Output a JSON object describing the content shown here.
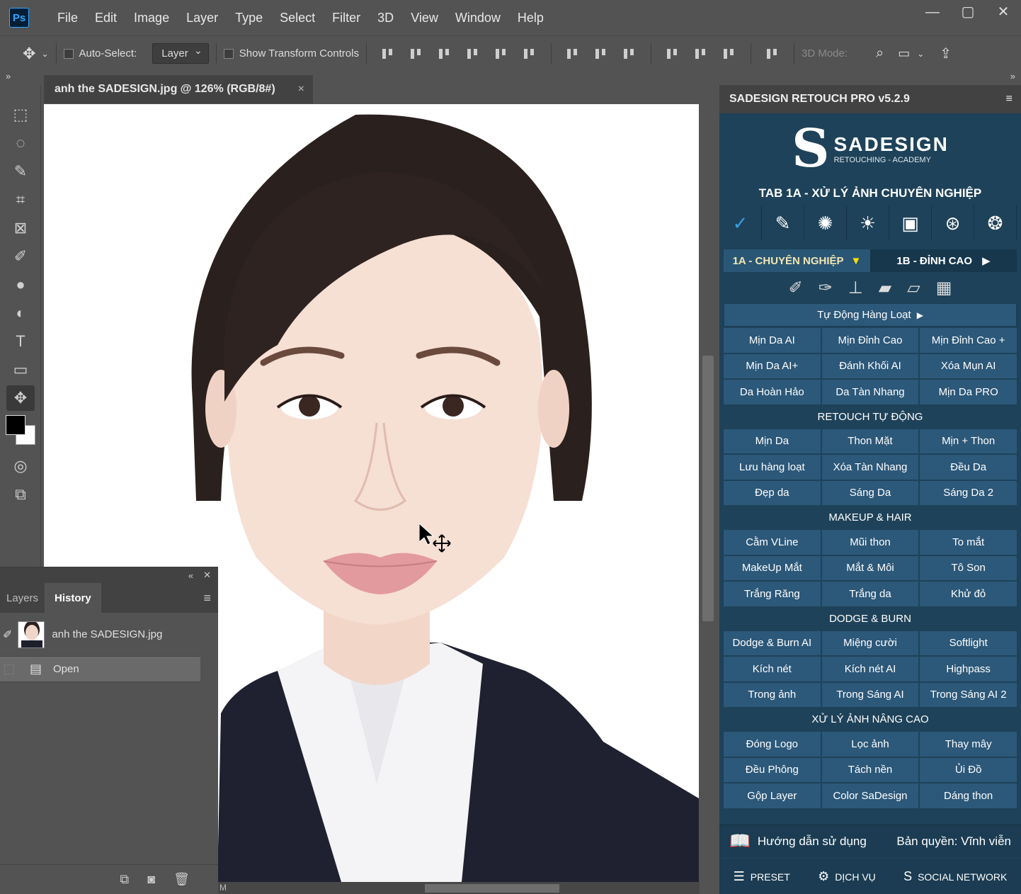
{
  "app": {
    "logo": "Ps"
  },
  "menu": [
    "File",
    "Edit",
    "Image",
    "Layer",
    "Type",
    "Select",
    "Filter",
    "3D",
    "View",
    "Window",
    "Help"
  ],
  "window_controls": [
    "—",
    "▢",
    "✕"
  ],
  "options": {
    "auto_select_label": "Auto-Select:",
    "auto_select_value": "Layer",
    "transform_label": "Show Transform Controls",
    "mode3d_label": "3D Mode:"
  },
  "document": {
    "tab_title": "anh the SADESIGN.jpg @ 126% (RGB/8#)",
    "close": "×"
  },
  "statusbar": {
    "zoom_fragment": "M"
  },
  "history_panel": {
    "tabs": [
      "Layers",
      "History"
    ],
    "snapshot_label": "anh the SADESIGN.jpg",
    "states": [
      "Open"
    ]
  },
  "sadesign": {
    "header": "SADESIGN RETOUCH PRO v5.2.9",
    "logo_main": "SADESIGN",
    "logo_sub": "RETOUCHING - ACADEMY",
    "title": "TAB 1A - XỬ LÝ ẢNH CHUYÊN NGHIỆP",
    "subtab_a": "1A - CHUYÊN NGHIỆP",
    "subtab_b": "1B - ĐỈNH CAO",
    "auto_batch": "Tự Động Hàng Loạt",
    "group1": [
      "Mịn Da AI",
      "Mịn Đỉnh Cao",
      "Mịn Đỉnh Cao +",
      "Mịn Da AI+",
      "Đánh Khối AI",
      "Xóa Mụn AI",
      "Da Hoàn Hảo",
      "Da Tàn Nhang",
      "Mịn Da PRO"
    ],
    "section_retouch": "RETOUCH TỰ ĐỘNG",
    "group2": [
      "Mịn Da",
      "Thon Mặt",
      "Mịn + Thon",
      "Lưu hàng loạt",
      "Xóa Tàn Nhang",
      "Đều Da",
      "Đẹp da",
      "Sáng Da",
      "Sáng Da 2"
    ],
    "section_makeup": "MAKEUP & HAIR",
    "group3": [
      "Cằm VLine",
      "Mũi thon",
      "To mắt",
      "MakeUp Mắt",
      "Mắt & Môi",
      "Tô Son",
      "Trắng Răng",
      "Trắng da",
      "Khử đỏ"
    ],
    "section_dodge": "DODGE & BURN",
    "group4": [
      "Dodge & Burn AI",
      "Miệng cười",
      "Softlight",
      "Kích nét",
      "Kích nét AI",
      "Highpass",
      "Trong ảnh",
      "Trong Sáng AI",
      "Trong Sáng AI 2"
    ],
    "section_advanced": "XỬ LÝ ẢNH NÂNG CAO",
    "group5": [
      "Đóng Logo",
      "Lọc ảnh",
      "Thay mây",
      "Đều Phông",
      "Tách nền",
      "Ủi Đồ",
      "Gộp Layer",
      "Color SaDesign",
      "Dáng thon"
    ],
    "guide": "Hướng dẫn sử dụng",
    "license": "Bản quyền: Vĩnh viễn",
    "preset": "PRESET",
    "service": "DỊCH VỤ",
    "social": "SOCIAL NETWORK"
  }
}
